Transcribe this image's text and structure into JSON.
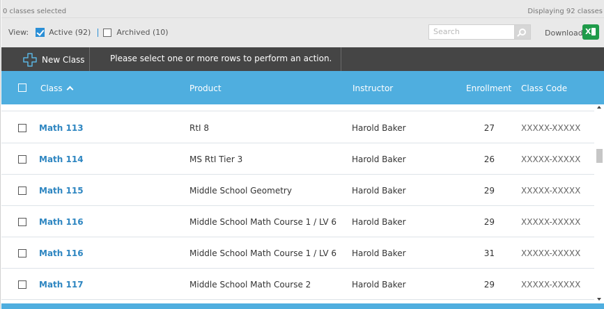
{
  "status": {
    "selected_text": "0 classes selected",
    "displaying_text": "Displaying 92 classes"
  },
  "filters": {
    "view_label": "View:",
    "active_label": "Active (92)",
    "active_checked": true,
    "archived_label": "Archived (10)",
    "archived_checked": false
  },
  "search": {
    "placeholder": "Search"
  },
  "download": {
    "label": "Download",
    "icon": "excel-icon"
  },
  "actions": {
    "new_class_label": "New Class",
    "message": "Please select one or more rows to perform an action."
  },
  "table": {
    "columns": {
      "class": "Class",
      "product": "Product",
      "instructor": "Instructor",
      "enrollment": "Enrollment",
      "class_code": "Class Code"
    },
    "sort": {
      "column": "class",
      "direction": "ascending"
    },
    "rows": [
      {
        "class": "Math 113",
        "product": "RtI 8",
        "instructor": "Harold Baker",
        "enrollment": "27",
        "code": "XXXXX-XXXXX"
      },
      {
        "class": "Math 114",
        "product": "MS RtI Tier 3",
        "instructor": "Harold Baker",
        "enrollment": "26",
        "code": "XXXXX-XXXXX"
      },
      {
        "class": "Math 115",
        "product": "Middle School Geometry",
        "instructor": "Harold Baker",
        "enrollment": "29",
        "code": "XXXXX-XXXXX"
      },
      {
        "class": "Math 116",
        "product": "Middle School Math Course 1 / LV 6",
        "instructor": "Harold Baker",
        "enrollment": "29",
        "code": "XXXXX-XXXXX"
      },
      {
        "class": "Math 116",
        "product": "Middle School Math Course 1 / LV 6",
        "instructor": "Harold Baker",
        "enrollment": "31",
        "code": "XXXXX-XXXXX"
      },
      {
        "class": "Math 117",
        "product": "Middle School Math Course 2",
        "instructor": "Harold Baker",
        "enrollment": "29",
        "code": "XXXXX-XXXXX"
      }
    ]
  },
  "colors": {
    "header_blue": "#4faedf",
    "action_bar": "#454545",
    "link_blue": "#2e86c1",
    "excel_green": "#1f9b4a"
  }
}
